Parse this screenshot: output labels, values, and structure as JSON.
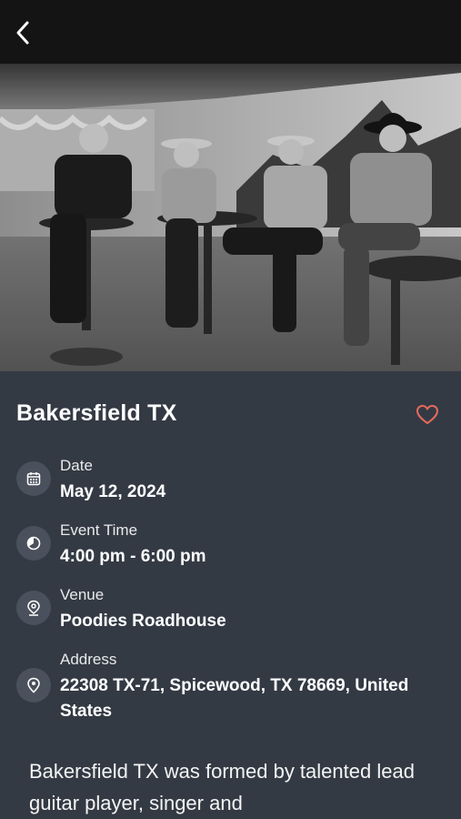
{
  "header": {
    "back_icon": "chevron-left-icon"
  },
  "hero": {
    "alt": "Band photo"
  },
  "event": {
    "title": "Bakersfield TX",
    "favorite_icon": "heart-outline-icon",
    "accent_color": "#e46a5c"
  },
  "details": [
    {
      "label": "Date",
      "value": "May 12, 2024",
      "icon": "calendar-icon"
    },
    {
      "label": "Event Time",
      "value": "4:00 pm - 6:00 pm",
      "icon": "clock-icon"
    },
    {
      "label": "Venue",
      "value": "Poodies Roadhouse",
      "icon": "location-pin-icon"
    },
    {
      "label": "Address",
      "value": "22308 TX-71, Spicewood, TX 78669, United States",
      "icon": "map-pin-icon"
    }
  ],
  "description": "Bakersfield TX was formed by talented lead guitar player, singer and"
}
